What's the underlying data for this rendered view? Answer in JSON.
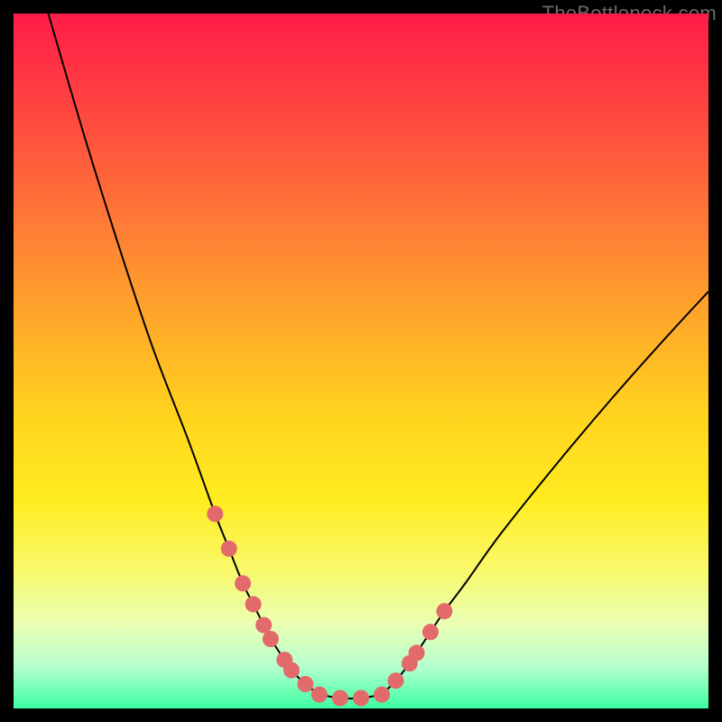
{
  "watermark": "TheBottleneck.com",
  "colors": {
    "background": "#000000",
    "gradient_top": "#ff1c48",
    "gradient_bottom": "#3bffa2",
    "curve": "#000000",
    "marker": "#e36a6a",
    "watermark_text": "#6a6a6a"
  },
  "chart_data": {
    "type": "line",
    "title": "",
    "xlabel": "",
    "ylabel": "",
    "x_range_pct": [
      0,
      100
    ],
    "y_range_pct": [
      0,
      100
    ],
    "series": [
      {
        "name": "curve-left",
        "x_pct": [
          5,
          10,
          15,
          20,
          25,
          29,
          31,
          33,
          34.5,
          36,
          37,
          39,
          40,
          42,
          44
        ],
        "y_pct": [
          0,
          17,
          33,
          48,
          61,
          72,
          77,
          82,
          85,
          88,
          90,
          93,
          94.5,
          96.5,
          98
        ]
      },
      {
        "name": "curve-right",
        "x_pct": [
          53,
          55,
          57,
          58,
          60,
          62,
          65,
          70,
          78,
          86,
          94,
          100
        ],
        "y_pct": [
          98,
          96,
          93.5,
          92,
          89,
          86,
          82,
          75,
          65,
          55.5,
          46.5,
          40
        ]
      },
      {
        "name": "valley-floor",
        "x_pct": [
          44,
          47,
          50,
          53
        ],
        "y_pct": [
          98,
          98.5,
          98.5,
          98
        ]
      }
    ],
    "markers": {
      "name": "data-points",
      "x_pct": [
        29,
        31,
        33,
        34.5,
        36,
        37,
        39,
        40,
        42,
        44,
        47,
        50,
        53,
        55,
        57,
        58,
        60,
        62
      ],
      "y_pct": [
        72,
        77,
        82,
        85,
        88,
        90,
        93,
        94.5,
        96.5,
        98,
        98.5,
        98.5,
        98,
        96,
        93.5,
        92,
        89,
        86
      ]
    }
  }
}
